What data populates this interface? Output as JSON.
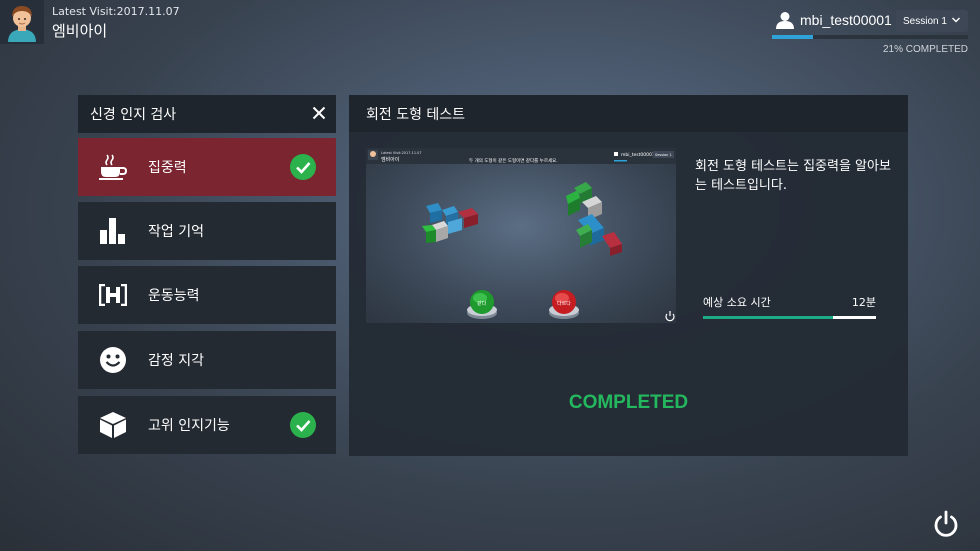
{
  "header": {
    "last_visit": "Latest Visit:2017.11.07",
    "app_name": "엠비아이",
    "username": "mbi_test00001",
    "session_label": "Session 1",
    "progress_percent": 21,
    "progress_text": "21% COMPLETED"
  },
  "sidebar": {
    "title": "신경 인지 검사",
    "items": [
      {
        "label": "집중력",
        "icon": "coffee-cup-icon",
        "active": true,
        "completed": true
      },
      {
        "label": "작업 기억",
        "icon": "bar-chart-icon",
        "active": false,
        "completed": false
      },
      {
        "label": "운동능력",
        "icon": "dumbbell-icon",
        "active": false,
        "completed": false
      },
      {
        "label": "감정 지각",
        "icon": "smiley-icon",
        "active": false,
        "completed": false
      },
      {
        "label": "고위 인지기능",
        "icon": "cube-icon",
        "active": false,
        "completed": true
      }
    ]
  },
  "test": {
    "title": "회전 도형 테스트",
    "description": "회전 도형 테스트는 집중력을 알아보는 테스트입니다.",
    "time_label": "예상 소요 시간",
    "time_value": "12분",
    "time_progress_percent": 75,
    "status": "COMPLETED",
    "preview": {
      "last_visit": "Latest Visit:2017.11.07",
      "app_name": "엠비아이",
      "instruction": "두 개의 도형이 같은 도형이면 같다를 누르세요.",
      "username": "mbi_test00001",
      "session_label": "Session 1",
      "same_button": "같다",
      "diff_button": "다르다"
    }
  },
  "colors": {
    "accent_active": "#7a2530",
    "check_green": "#2bb24c",
    "completed_green": "#24b85e",
    "progress_blue": "#2fa2d9",
    "time_fill": "#1cab84"
  }
}
